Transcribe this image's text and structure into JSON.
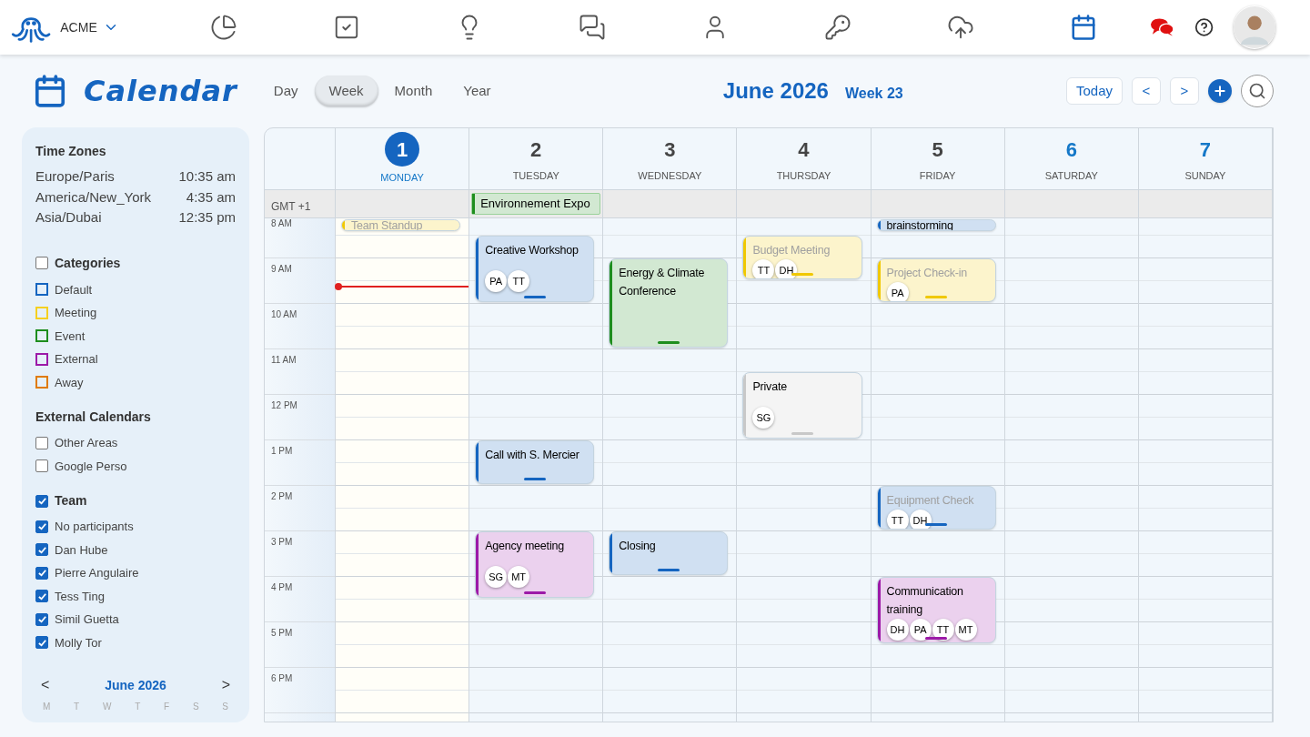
{
  "topbar": {
    "brand": "ACME",
    "nav": [
      {
        "selected": false
      },
      {
        "selected": false
      },
      {
        "selected": false
      },
      {
        "selected": false
      },
      {
        "selected": false
      },
      {
        "selected": false
      },
      {
        "selected": false
      },
      {
        "selected": true
      }
    ]
  },
  "header": {
    "title": "Calendar",
    "views": [
      {
        "label": "Day",
        "selected": false
      },
      {
        "label": "Week",
        "selected": true
      },
      {
        "label": "Month",
        "selected": false
      },
      {
        "label": "Year",
        "selected": false
      }
    ],
    "period": "June 2026",
    "week": "Week 23",
    "today": "Today",
    "prev": "<",
    "next": ">"
  },
  "sidebar": {
    "time_zones": {
      "title": "Time Zones",
      "rows": [
        {
          "zone": "Europe/Paris",
          "time": "10:35 am"
        },
        {
          "zone": "America/New_York",
          "time": "4:35 am"
        },
        {
          "zone": "Asia/Dubai",
          "time": "12:35 pm"
        }
      ]
    },
    "categories": {
      "title": "Categories",
      "checked": false,
      "items": [
        {
          "label": "Default",
          "color": "#1565c0"
        },
        {
          "label": "Meeting",
          "color": "#f5d020"
        },
        {
          "label": "Event",
          "color": "#1e8e1e"
        },
        {
          "label": "External",
          "color": "#9c1aa8"
        },
        {
          "label": "Away",
          "color": "#e07b00"
        }
      ]
    },
    "external_calendars": {
      "title": "External Calendars",
      "items": [
        {
          "label": "Other Areas",
          "checked": false
        },
        {
          "label": "Google Perso",
          "checked": false
        }
      ]
    },
    "team": {
      "title": "Team",
      "checked": true,
      "items": [
        {
          "label": "No participants",
          "checked": true
        },
        {
          "label": "Dan Hube",
          "checked": true
        },
        {
          "label": "Pierre Angulaire",
          "checked": true
        },
        {
          "label": "Tess Ting",
          "checked": true
        },
        {
          "label": "Simil Guetta",
          "checked": true
        },
        {
          "label": "Molly Tor",
          "checked": true
        }
      ]
    },
    "mini_calendar": {
      "prev": "<",
      "month": "June 2026",
      "next": ">",
      "weekdays": [
        "M",
        "T",
        "W",
        "T",
        "F",
        "S",
        "S"
      ]
    }
  },
  "week": {
    "timezone": "GMT +1",
    "hours": [
      "8 AM",
      "9 AM",
      "10 AM",
      "11 AM",
      "12 PM",
      "1 PM",
      "2 PM",
      "3 PM",
      "4 PM",
      "5 PM",
      "6 PM"
    ],
    "days": [
      {
        "number": "1",
        "name": "MONDAY",
        "today": true,
        "weekend": false,
        "events": [
          {
            "title": "Team Standup",
            "color": "#f0c800",
            "dimmed": true
          }
        ]
      },
      {
        "number": "2",
        "name": "TUESDAY",
        "today": false,
        "weekend": false,
        "all_day": [
          {
            "title": "Environnement Expo",
            "color": "#1e8e1e"
          }
        ],
        "events": [
          {
            "title": "Creative Workshop",
            "color": "#1565c0",
            "dimmed": false,
            "participants": [
              "PA",
              "TT"
            ]
          },
          {
            "title": "Call with S. Mercier",
            "color": "#1565c0",
            "dimmed": false
          },
          {
            "title": "Agency meeting",
            "color": "#9c1aa8",
            "dimmed": false,
            "participants": [
              "SG",
              "MT"
            ]
          }
        ]
      },
      {
        "number": "3",
        "name": "WEDNESDAY",
        "today": false,
        "weekend": false,
        "events": [
          {
            "title": "Energy & Climate Conference",
            "color": "#1e8e1e",
            "dimmed": false
          },
          {
            "title": "Closing",
            "color": "#1565c0",
            "dimmed": false
          }
        ]
      },
      {
        "number": "4",
        "name": "THURSDAY",
        "today": false,
        "weekend": false,
        "events": [
          {
            "title": "Budget Meeting",
            "color": "#f0c800",
            "dimmed": true,
            "participants": [
              "TT",
              "DH"
            ]
          },
          {
            "title": "Private",
            "color": "#c8c8c8",
            "dimmed": false,
            "participants": [
              "SG"
            ]
          }
        ]
      },
      {
        "number": "5",
        "name": "FRIDAY",
        "today": false,
        "weekend": false,
        "events": [
          {
            "title": "brainstorming",
            "color": "#1565c0",
            "dimmed": false
          },
          {
            "title": "Project Check-in",
            "color": "#f0c800",
            "dimmed": true,
            "participants": [
              "PA"
            ]
          },
          {
            "title": "Equipment Check",
            "color": "#1565c0",
            "dimmed": true,
            "participants": [
              "TT",
              "DH"
            ]
          },
          {
            "title": "Communication training",
            "color": "#9c1aa8",
            "dimmed": false,
            "participants": [
              "DH",
              "PA",
              "TT",
              "MT"
            ]
          }
        ]
      },
      {
        "number": "6",
        "name": "SATURDAY",
        "today": false,
        "weekend": true
      },
      {
        "number": "7",
        "name": "SUNDAY",
        "today": false,
        "weekend": true
      }
    ]
  }
}
